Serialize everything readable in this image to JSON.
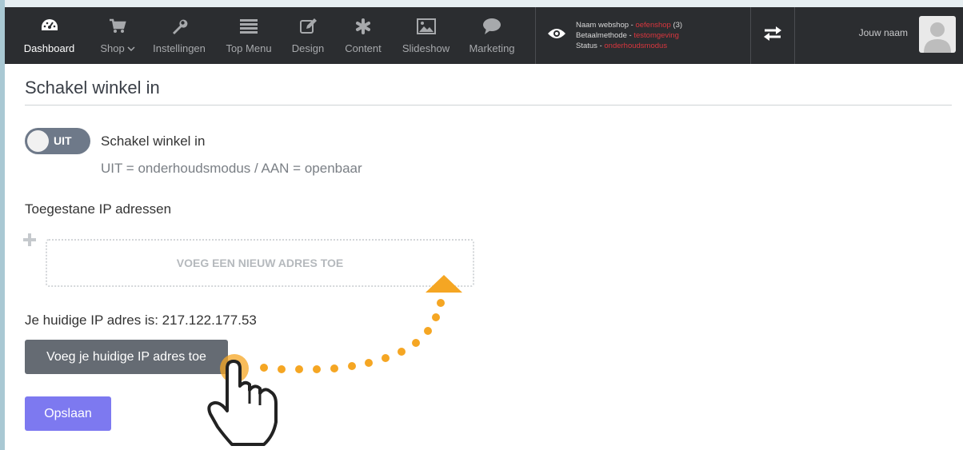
{
  "nav": {
    "items": [
      {
        "label": "Dashboard",
        "icon": "dashboard-icon",
        "active": true
      },
      {
        "label": "Shop",
        "icon": "cart-icon",
        "dropdown": true
      },
      {
        "label": "Instellingen",
        "icon": "wrench-icon"
      },
      {
        "label": "Top Menu",
        "icon": "menu-list-icon"
      },
      {
        "label": "Design",
        "icon": "edit-icon"
      },
      {
        "label": "Content",
        "icon": "asterisk-icon"
      },
      {
        "label": "Slideshow",
        "icon": "image-icon"
      },
      {
        "label": "Marketing",
        "icon": "chat-icon"
      }
    ]
  },
  "status": {
    "name_label": "Naam webshop - ",
    "name_value": "oefenshop",
    "name_count": " (3)",
    "payment_label": "Betaalmethode - ",
    "payment_value": "testomgeving",
    "status_label": "Status - ",
    "status_value": "onderhoudsmodus"
  },
  "user": {
    "name": "Jouw naam"
  },
  "page": {
    "title": "Schakel winkel in",
    "toggle_state": "UIT",
    "toggle_title": "Schakel winkel in",
    "toggle_desc": "UIT = onderhoudsmodus / AAN = openbaar",
    "ip_heading": "Toegestane IP adressen",
    "add_box_label": "VOEG EEN NIEUW ADRES TOE",
    "current_ip_label": "Je huidige IP adres is: 217.122.177.53",
    "add_ip_button": "Voeg je huidige IP adres toe",
    "save_button": "Opslaan"
  },
  "colors": {
    "nav_bg": "#2b2d30",
    "accent_red": "#d9363e",
    "toggle_off": "#6e7989",
    "save_button": "#7d79f0",
    "annotation_orange": "#f5a623"
  }
}
